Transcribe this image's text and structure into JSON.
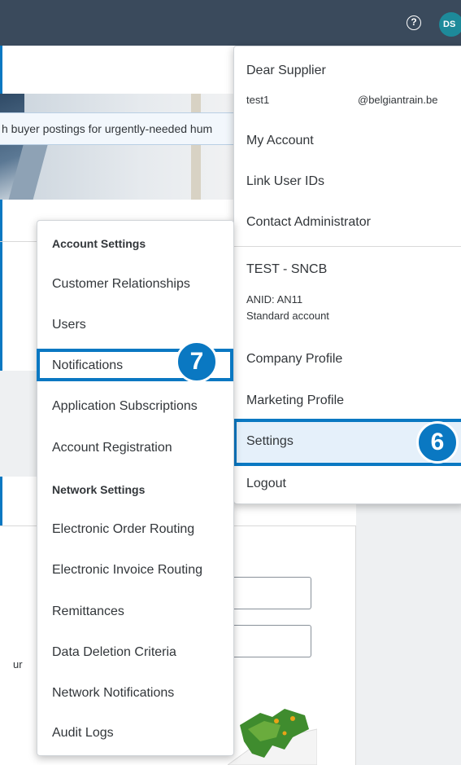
{
  "header": {
    "help_icon": "question-circle-icon",
    "help_glyph": "?",
    "avatar_initials": "DS"
  },
  "banner": {
    "text": "h buyer postings for urgently-needed hum"
  },
  "background": {
    "fragment_text": "ur"
  },
  "user_menu": {
    "greeting": "Dear Supplier",
    "username": "test1",
    "email_domain": "@belgiantrain.be",
    "items": [
      "My Account",
      "Link User IDs",
      "Contact Administrator"
    ],
    "company_name": "TEST - SNCB",
    "anid": "ANID: AN11",
    "account_type": "Standard account",
    "company_items": [
      "Company Profile",
      "Marketing Profile",
      "Settings",
      "Logout"
    ]
  },
  "settings_menu": {
    "account_heading": "Account Settings",
    "account_items": [
      "Customer Relationships",
      "Users",
      "Notifications",
      "Application Subscriptions",
      "Account Registration"
    ],
    "network_heading": "Network Settings",
    "network_items": [
      "Electronic Order Routing",
      "Electronic Invoice Routing",
      "Remittances",
      "Data Deletion Criteria",
      "Network Notifications",
      "Audit Logs"
    ]
  },
  "callouts": {
    "step_settings": "6",
    "step_notifications": "7"
  },
  "colors": {
    "topbar": "#3a4a5c",
    "accent": "#0a78c2",
    "avatar": "#1d8a9a",
    "selected_row": "#e5f0fa"
  }
}
